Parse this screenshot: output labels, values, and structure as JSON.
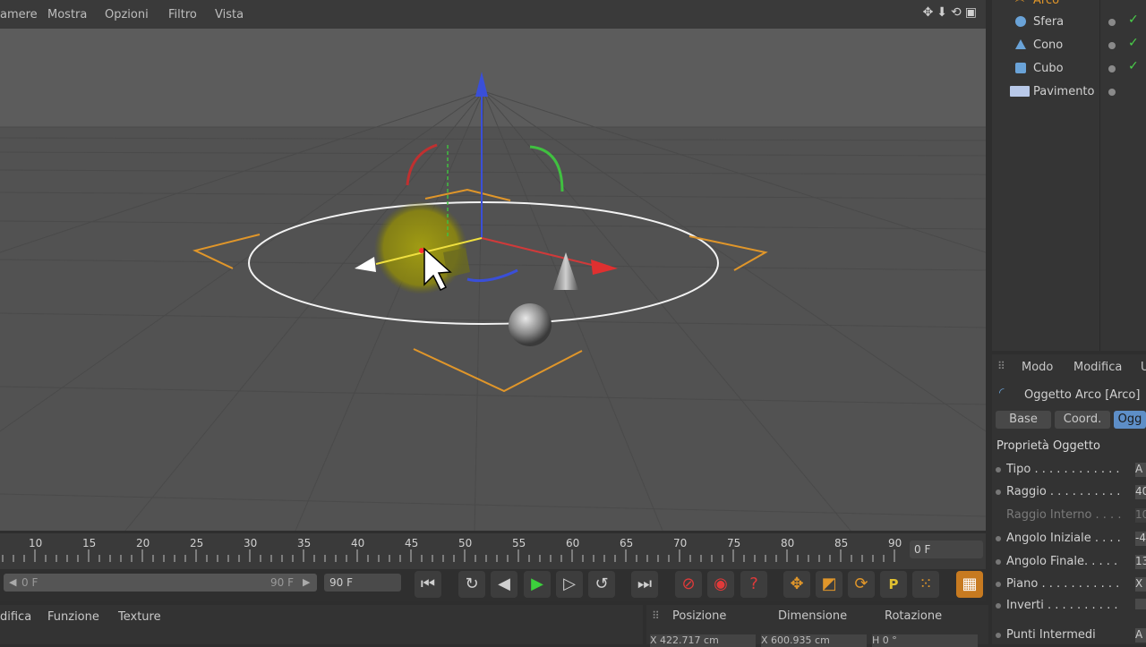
{
  "viewport": {
    "menu": [
      "amere",
      "Mostra",
      "Opzioni",
      "Filtro",
      "Vista"
    ],
    "icons": [
      "move-icon",
      "zoom-icon",
      "rotate-icon",
      "maximize-icon"
    ]
  },
  "object_manager": {
    "items": [
      {
        "name": "Arco",
        "icon": "arc-icon"
      },
      {
        "name": "Sfera",
        "icon": "sphere-icon"
      },
      {
        "name": "Cono",
        "icon": "cone-icon"
      },
      {
        "name": "Cubo",
        "icon": "cube-icon"
      },
      {
        "name": "Pavimento",
        "icon": "floor-icon"
      }
    ]
  },
  "attribute_manager": {
    "menu": [
      "Modo",
      "Modifica",
      "U"
    ],
    "object_title": "Oggetto Arco [Arco]",
    "tabs": [
      "Base",
      "Coord.",
      "Ogg"
    ],
    "section": "Proprietà Oggetto",
    "properties": [
      {
        "label": "Tipo . . . . . . . . . . . .",
        "value": "A"
      },
      {
        "label": "Raggio . . . . . . . . . .",
        "value": "40"
      },
      {
        "label": "Raggio Interno . . . .",
        "value": "10"
      },
      {
        "label": "Angolo Iniziale . . . .",
        "value": "-4"
      },
      {
        "label": "Angolo Finale. . . . .",
        "value": "13"
      },
      {
        "label": "Piano . . . . . . . . . . .",
        "value": "X"
      },
      {
        "label": "Inverti . . . . . . . . . .",
        "value": ""
      },
      {
        "label": "Punti Intermedi",
        "value": "A"
      }
    ]
  },
  "timeline": {
    "ticks": [
      "10",
      "15",
      "20",
      "25",
      "30",
      "35",
      "40",
      "45",
      "50",
      "55",
      "60",
      "65",
      "70",
      "75",
      "80",
      "85",
      "90"
    ],
    "current_frame": "0 F"
  },
  "transport": {
    "range_start": "0 F",
    "range_end": "90 F",
    "end_field": "90 F",
    "record_icons": [
      "record-icon",
      "autokey-icon",
      "help-icon"
    ],
    "tool_icons": [
      "move-icon",
      "scale-icon",
      "rotate-icon",
      "param-icon",
      "points-icon"
    ],
    "param_label": "P"
  },
  "material_manager": {
    "menu": [
      "difica",
      "Funzione",
      "Texture"
    ]
  },
  "coordinates": {
    "headers": [
      "Posizione",
      "Dimensione",
      "Rotazione"
    ],
    "values": [
      "X  422.717 cm",
      "X  600.935 cm",
      "H  0 °"
    ]
  }
}
